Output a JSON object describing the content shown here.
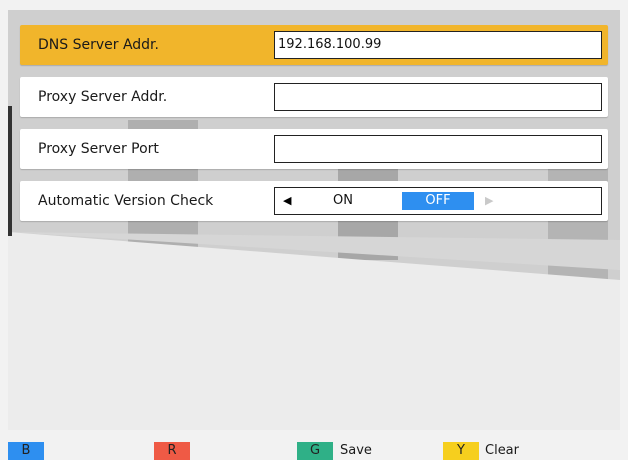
{
  "settings": {
    "dns": {
      "label": "DNS Server Addr.",
      "value": "192.168.100.99"
    },
    "proxy_addr": {
      "label": "Proxy Server Addr.",
      "value": ""
    },
    "proxy_port": {
      "label": "Proxy Server Port",
      "value": ""
    },
    "auto_check": {
      "label": "Automatic Version Check",
      "options": [
        "ON",
        "OFF"
      ],
      "selected": "OFF",
      "arrow_left": "◀",
      "arrow_right": "▶"
    }
  },
  "footer": {
    "blue_key": "B",
    "red_key": "R",
    "green_key": "G",
    "green_label": "Save",
    "yellow_key": "Y",
    "yellow_label": "Clear"
  },
  "colors": {
    "selected_row": "#f1b52b",
    "toggle_active": "#2e8ff0",
    "key_blue": "#2e8ff0",
    "key_red": "#ef5a45",
    "key_green": "#2fb087",
    "key_yellow": "#f6cf1e"
  }
}
